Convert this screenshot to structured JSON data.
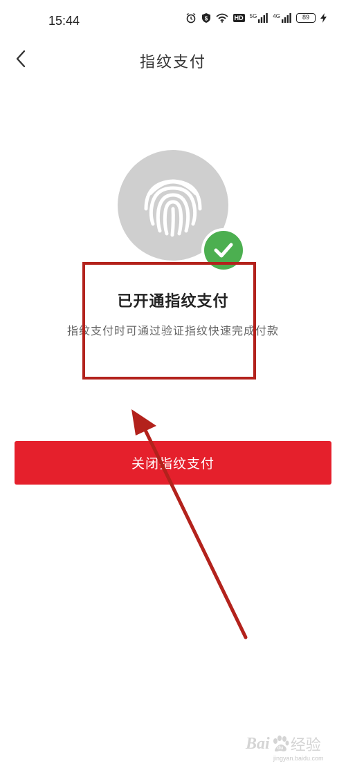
{
  "status_bar": {
    "time": "15:44",
    "battery_level": "89",
    "network_labels": [
      "5G",
      "4G"
    ],
    "hd_label": "HD",
    "icons": [
      "alarm-icon",
      "shield-icon",
      "wifi-icon",
      "hd-icon",
      "signal-icon",
      "signal-icon",
      "battery-icon",
      "charging-icon"
    ]
  },
  "nav": {
    "title": "指纹支付",
    "back_icon": "chevron-left-icon"
  },
  "content": {
    "status_title": "已开通指纹支付",
    "status_desc": "指纹支付时可通过验证指纹快速完成付款",
    "fingerprint_icon": "fingerprint-icon",
    "check_icon": "check-icon"
  },
  "actions": {
    "close_label": "关闭指纹支付"
  },
  "watermark": {
    "brand": "Bai",
    "word": "经验",
    "url": "jingyan.baidu.com"
  },
  "colors": {
    "accent": "#e5202c",
    "success": "#4caf50",
    "annotation": "#b3221c",
    "circle": "#cfcfcf"
  }
}
